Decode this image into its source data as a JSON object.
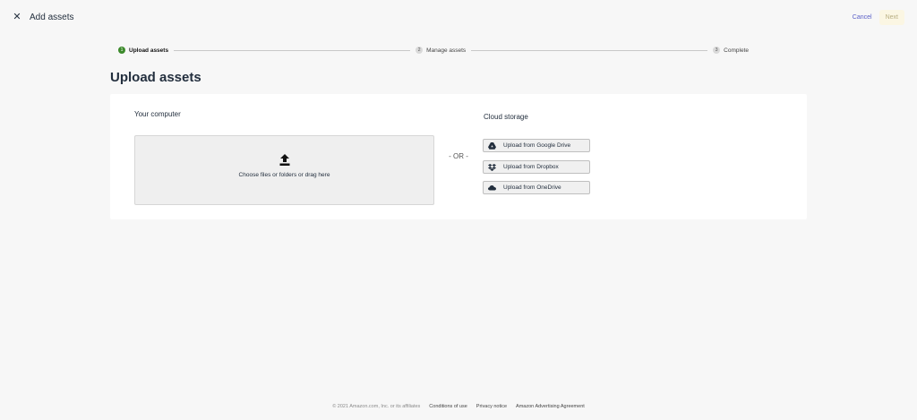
{
  "header": {
    "close_icon": "close-icon",
    "close_glyph": "✕",
    "title": "Add assets",
    "cancel_label": "Cancel",
    "next_label": "Next"
  },
  "stepper": {
    "steps": [
      {
        "number": "1",
        "label": "Upload assets",
        "state": "active"
      },
      {
        "number": "2",
        "label": "Manage assets",
        "state": "inactive"
      },
      {
        "number": "3",
        "label": "Complete",
        "state": "inactive"
      }
    ]
  },
  "main": {
    "title": "Upload assets",
    "your_computer": {
      "heading": "Your computer",
      "dropzone_icon": "upload-icon",
      "dropzone_text": "Choose files or folders or drag here"
    },
    "or_text": "- OR -",
    "cloud_storage": {
      "heading": "Cloud storage",
      "buttons": [
        {
          "icon": "google-drive-icon",
          "label": "Upload from Google Drive"
        },
        {
          "icon": "dropbox-icon",
          "label": "Upload from Dropbox"
        },
        {
          "icon": "onedrive-icon",
          "label": "Upload from OneDrive"
        }
      ]
    }
  },
  "footer": {
    "copyright": "© 2021 Amazon.com, Inc. or its affiliates",
    "links": [
      "Conditions of use",
      "Privacy notice",
      "Amazon Advertising Agreement"
    ]
  },
  "colors": {
    "background": "#f7f7f7",
    "active_step": "#3c8a2b",
    "link": "#5a5fc8",
    "next_button_bg": "#fbf6e3"
  }
}
